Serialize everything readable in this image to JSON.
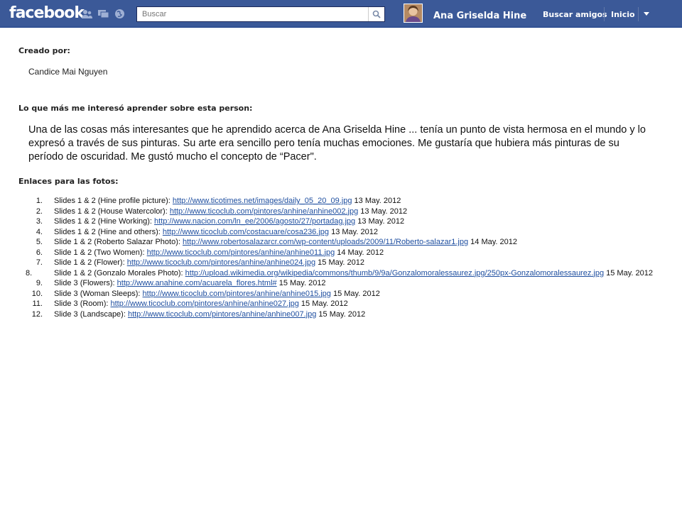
{
  "header": {
    "logo": "facebook",
    "search_placeholder": "Buscar",
    "user_name": "Ana Griselda Hine",
    "nav": [
      "Buscar amigos",
      "Inicio"
    ],
    "icons": [
      "friend-requests-icon",
      "messages-icon",
      "notifications-icon",
      "search-icon",
      "account-menu-caret-icon"
    ],
    "brand_color": "#3b5998"
  },
  "content": {
    "created_label": "Creado por:",
    "author": "Candice Mai Nguyen",
    "interest_label": "Lo que más me interesó aprender sobre esta person:",
    "paragraph": "Una de las cosas más interesantes que he aprendido acerca de Ana Griselda Hine ... tenía un punto de vista hermosa en el mundo y lo expresó a través de sus pinturas. Su arte era sencillo pero tenía muchas emociones. Me gustaría que hubiera más pinturas de su período de oscuridad. Me gustó mucho el concepto de “Pacer\".",
    "links_label": "Enlaces para las fotos:",
    "links": [
      {
        "num": "1.",
        "prefix": "Slides 1 & 2 (Hine profile picture): ",
        "url": "http://www.ticotimes.net/images/daily_05_20_09.jpg",
        "date": " 13 May. 2012"
      },
      {
        "num": "2.",
        "prefix": "Slides 1 & 2 (House Watercolor): ",
        "url": "http://www.ticoclub.com/pintores/anhine/anhine002.jpg",
        "date": " 13 May. 2012"
      },
      {
        "num": "3.",
        "prefix": "Slides 1 & 2 (Hine Working): ",
        "url": "http://www.nacion.com/ln_ee/2006/agosto/27/portadag.jpg",
        "date": " 13 May. 2012"
      },
      {
        "num": "4.",
        "prefix": "Slides 1 & 2 (Hine and others): ",
        "url": "http://www.ticoclub.com/costacuare/cosa236.jpg",
        "date": " 13 May. 2012"
      },
      {
        "num": "5.",
        "prefix": "Slide 1 & 2 (Roberto Salazar Photo): ",
        "url": "http://www.robertosalazarcr.com/wp-content/uploads/2009/11/Roberto-salazar1.jpg",
        "date": " 14 May. 2012"
      },
      {
        "num": "6.",
        "prefix": "Slide 1 & 2 (Two Women): ",
        "url": "http://www.ticoclub.com/pintores/anhine/anhine011.jpg",
        "date": " 14 May. 2012"
      },
      {
        "num": "7.",
        "prefix": "Slide 1 & 2 (Flower): ",
        "url": "http://www.ticoclub.com/pintores/anhine/anhine024.jpg",
        "date": " 15 May. 2012"
      },
      {
        "num": "8.",
        "prefix": "Slide 1 & 2 (Gonzalo Morales Photo): ",
        "url": "http://upload.wikimedia.org/wikipedia/commons/thumb/9/9a/Gonzalomoralessaurez.jpg/250px-Gonzalomoralessaurez.jpg",
        "date": " 15 May. 2012"
      },
      {
        "num": "9.",
        "prefix": "Slide 3 (Flowers): ",
        "url": "http://www.anahine.com/acuarela_flores.html#",
        "date": " 15 May. 2012"
      },
      {
        "num": "10.",
        "prefix": "Slide 3 (Woman Sleeps): ",
        "url": "http://www.ticoclub.com/pintores/anhine/anhine015.jpg",
        "date": " 15 May. 2012"
      },
      {
        "num": "11.",
        "prefix": "Slide 3 (Room): ",
        "url": "http://www.ticoclub.com/pintores/anhine/anhine027.jpg",
        "date": " 15 May. 2012"
      },
      {
        "num": "12.",
        "prefix": "Slide 3 (Landscape): ",
        "url": "http://www.ticoclub.com/pintores/anhine/anhine007.jpg",
        "date": " 15 May. 2012"
      }
    ]
  }
}
